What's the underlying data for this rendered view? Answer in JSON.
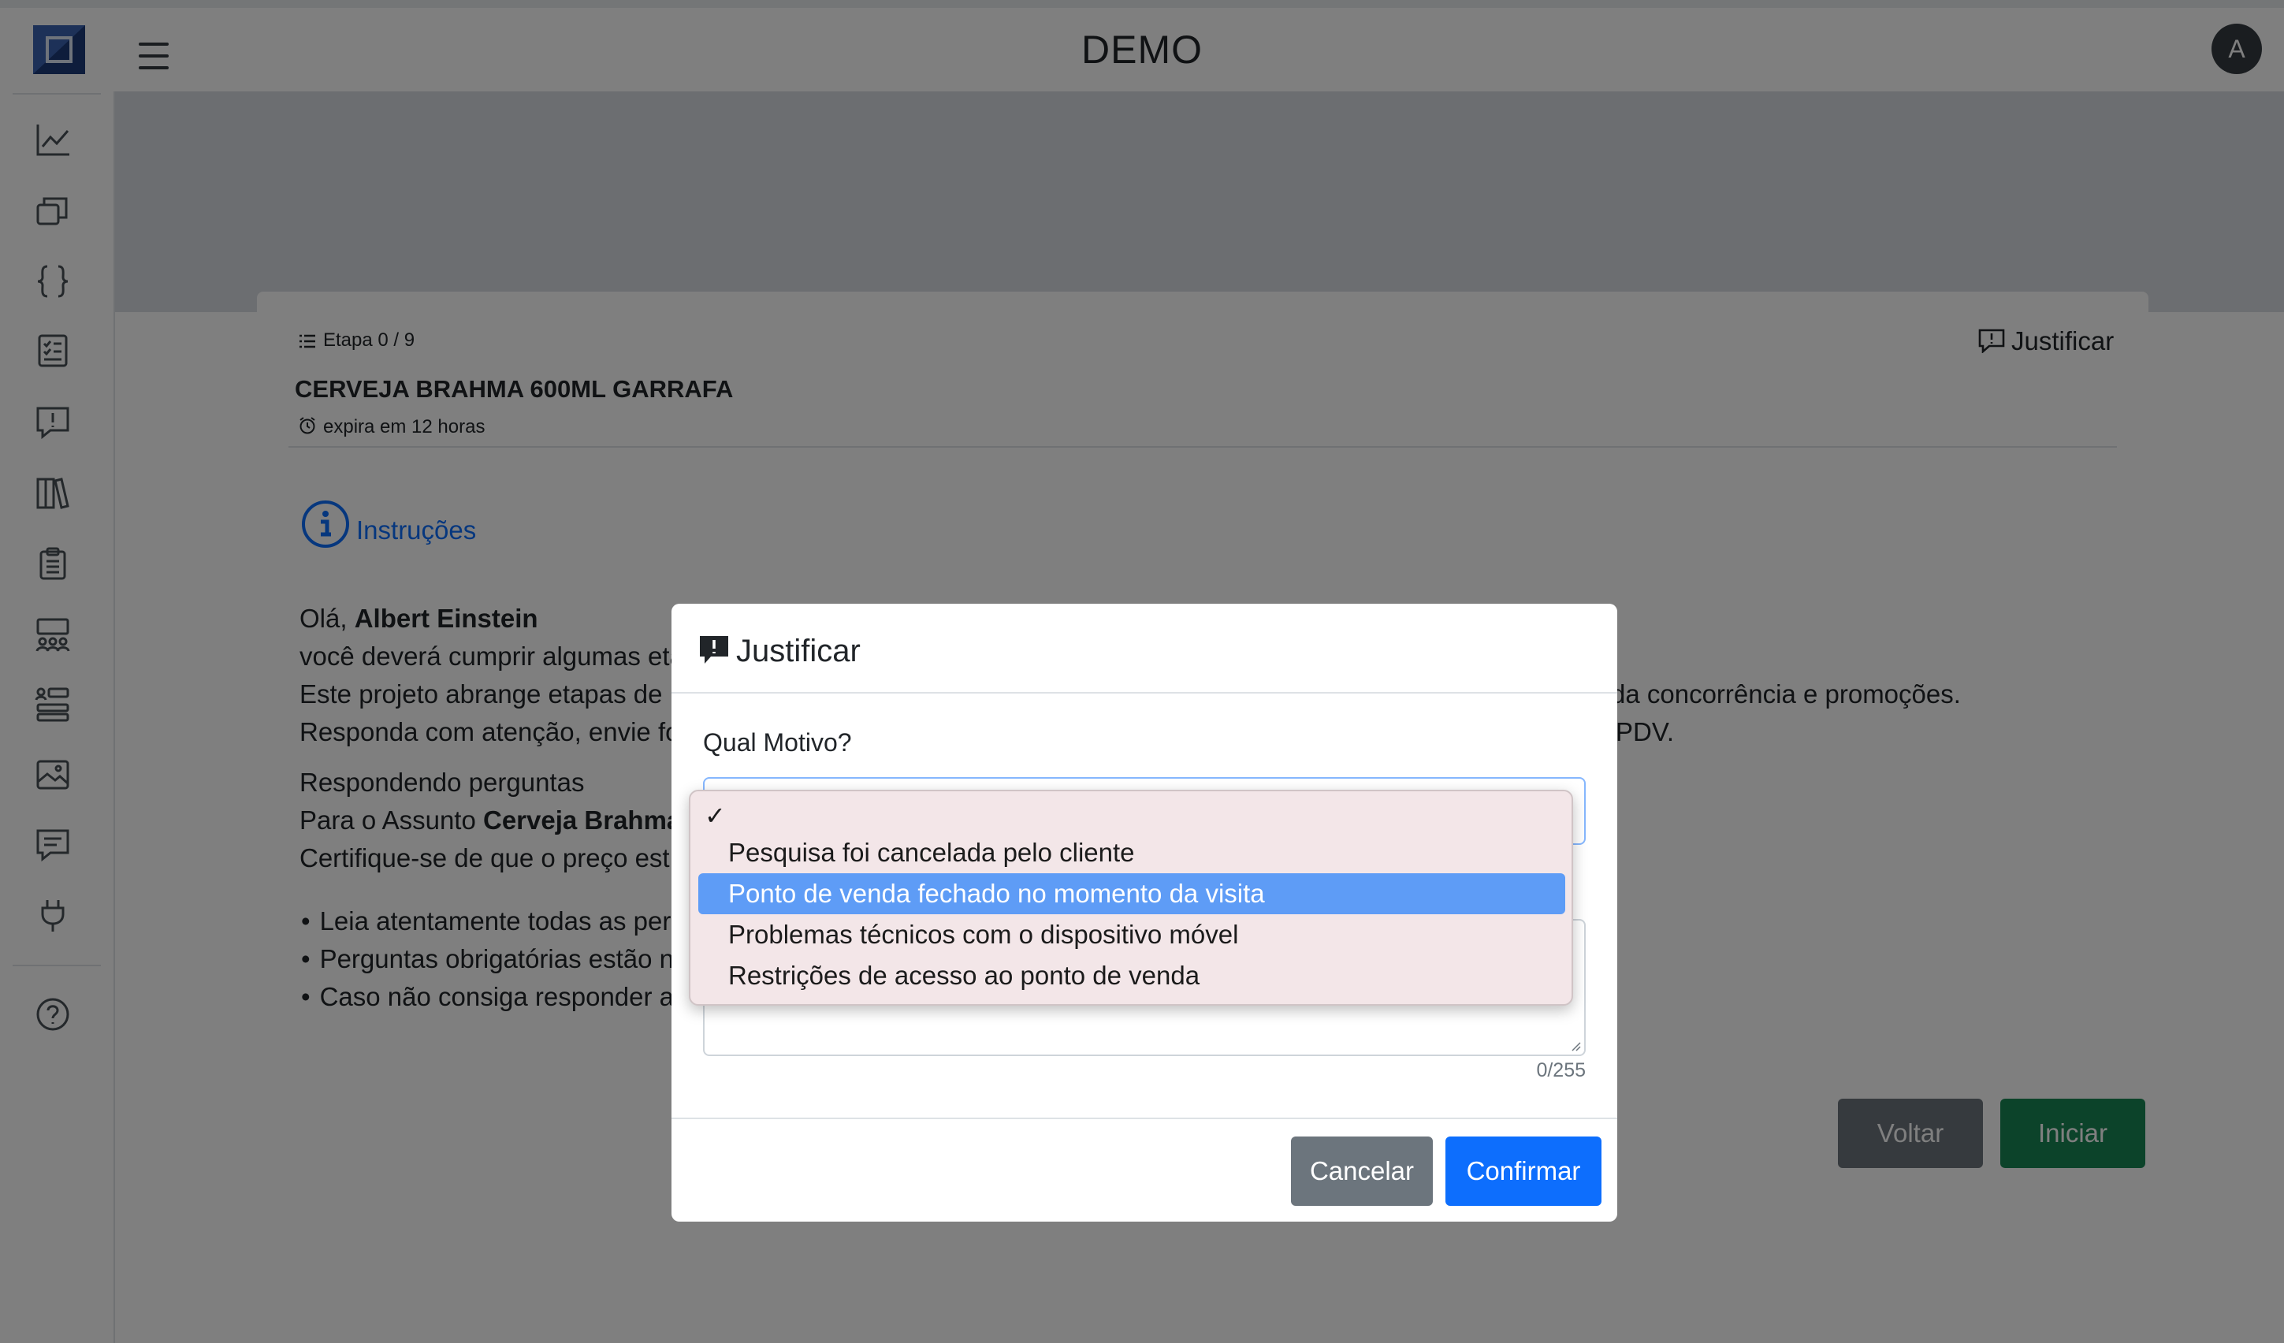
{
  "header": {
    "app_title": "DEMO",
    "avatar_initial": "A"
  },
  "sidebar": {
    "icons": [
      "line-chart-icon",
      "stacked-windows-icon",
      "braces-icon",
      "checklist-icon",
      "alert-message-icon",
      "library-icon",
      "clipboard-icon",
      "team-icon",
      "list-settings-icon",
      "image-icon",
      "chat-icon",
      "plug-icon",
      "help-icon"
    ]
  },
  "card": {
    "etapa": "Etapa 0 / 9",
    "justificar_label": "Justificar",
    "product_title": "CERVEJA BRAHMA 600ML GARRAFA",
    "expira": "expira em 12 horas",
    "instructions_label": "Instruções",
    "greeting_prefix": "Olá, ",
    "greeting_name": "Albert Einstein",
    "line2": "você deverá cumprir algumas eta",
    "line3_left": "Este projeto abrange etapas de",
    "line3_right": "da concorrência e promoções.",
    "line4_left": "Responda com atenção, envie fo",
    "line4_right": "PDV.",
    "respondendo": "Respondendo perguntas",
    "para_prefix": "Para o Assunto ",
    "para_bold": "Cerveja Brahma",
    "certifique": "Certifique-se de que o preço est",
    "bullets": [
      "Leia atentamente todas as per",
      "Perguntas obrigatórias estão n",
      "Caso não consiga responder a"
    ],
    "back_label": "Voltar",
    "start_label": "Iniciar"
  },
  "modal": {
    "title": "Justificar",
    "reason_label": "Qual Motivo?",
    "counter": "0/255",
    "cancel_label": "Cancelar",
    "confirm_label": "Confirmar",
    "dropdown": {
      "empty_option_check": "✓",
      "options": [
        "Pesquisa foi cancelada pelo cliente",
        "Ponto de venda fechado no momento da visita",
        "Problemas técnicos com o dispositivo móvel",
        "Restrições de acesso ao ponto de venda"
      ],
      "highlighted": "Ponto de venda fechado no momento da visita"
    }
  },
  "colors": {
    "primary": "#0d6efd",
    "success": "#198754",
    "secondary": "#6c757d",
    "dark": "#343a40"
  }
}
